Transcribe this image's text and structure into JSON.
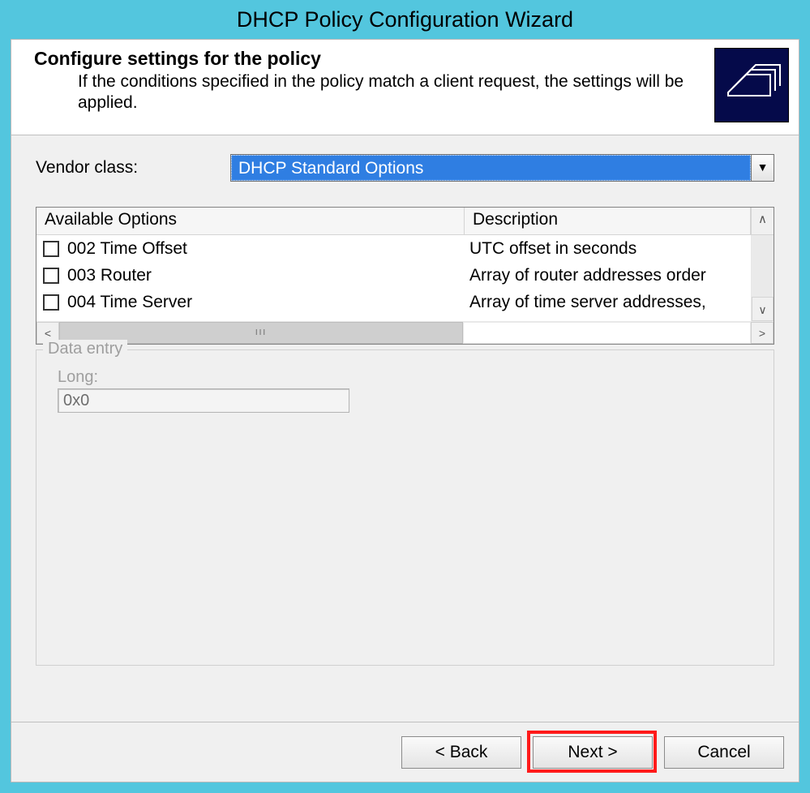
{
  "window": {
    "title": "DHCP Policy Configuration Wizard"
  },
  "header": {
    "title": "Configure settings for the policy",
    "description": "If the conditions specified in the policy match a client request, the settings will be applied.",
    "icon_name": "folder-stack-icon"
  },
  "vendor_class": {
    "label": "Vendor class:",
    "selected": "DHCP Standard Options"
  },
  "options_table": {
    "columns": {
      "options": "Available Options",
      "description": "Description"
    },
    "scroll_up_glyph": "∧",
    "scroll_down_glyph": "∨",
    "scroll_left_glyph": "<",
    "scroll_right_glyph": ">",
    "thumb_glyph": "III",
    "rows": [
      {
        "checked": false,
        "label": "002 Time Offset",
        "description": "UTC offset in seconds"
      },
      {
        "checked": false,
        "label": "003 Router",
        "description": "Array of router addresses order"
      },
      {
        "checked": false,
        "label": "004 Time Server",
        "description": "Array of time server addresses,"
      }
    ]
  },
  "data_entry": {
    "legend": "Data entry",
    "long_label": "Long:",
    "long_value": "0x0"
  },
  "buttons": {
    "back": "< Back",
    "next": "Next >",
    "cancel": "Cancel"
  }
}
